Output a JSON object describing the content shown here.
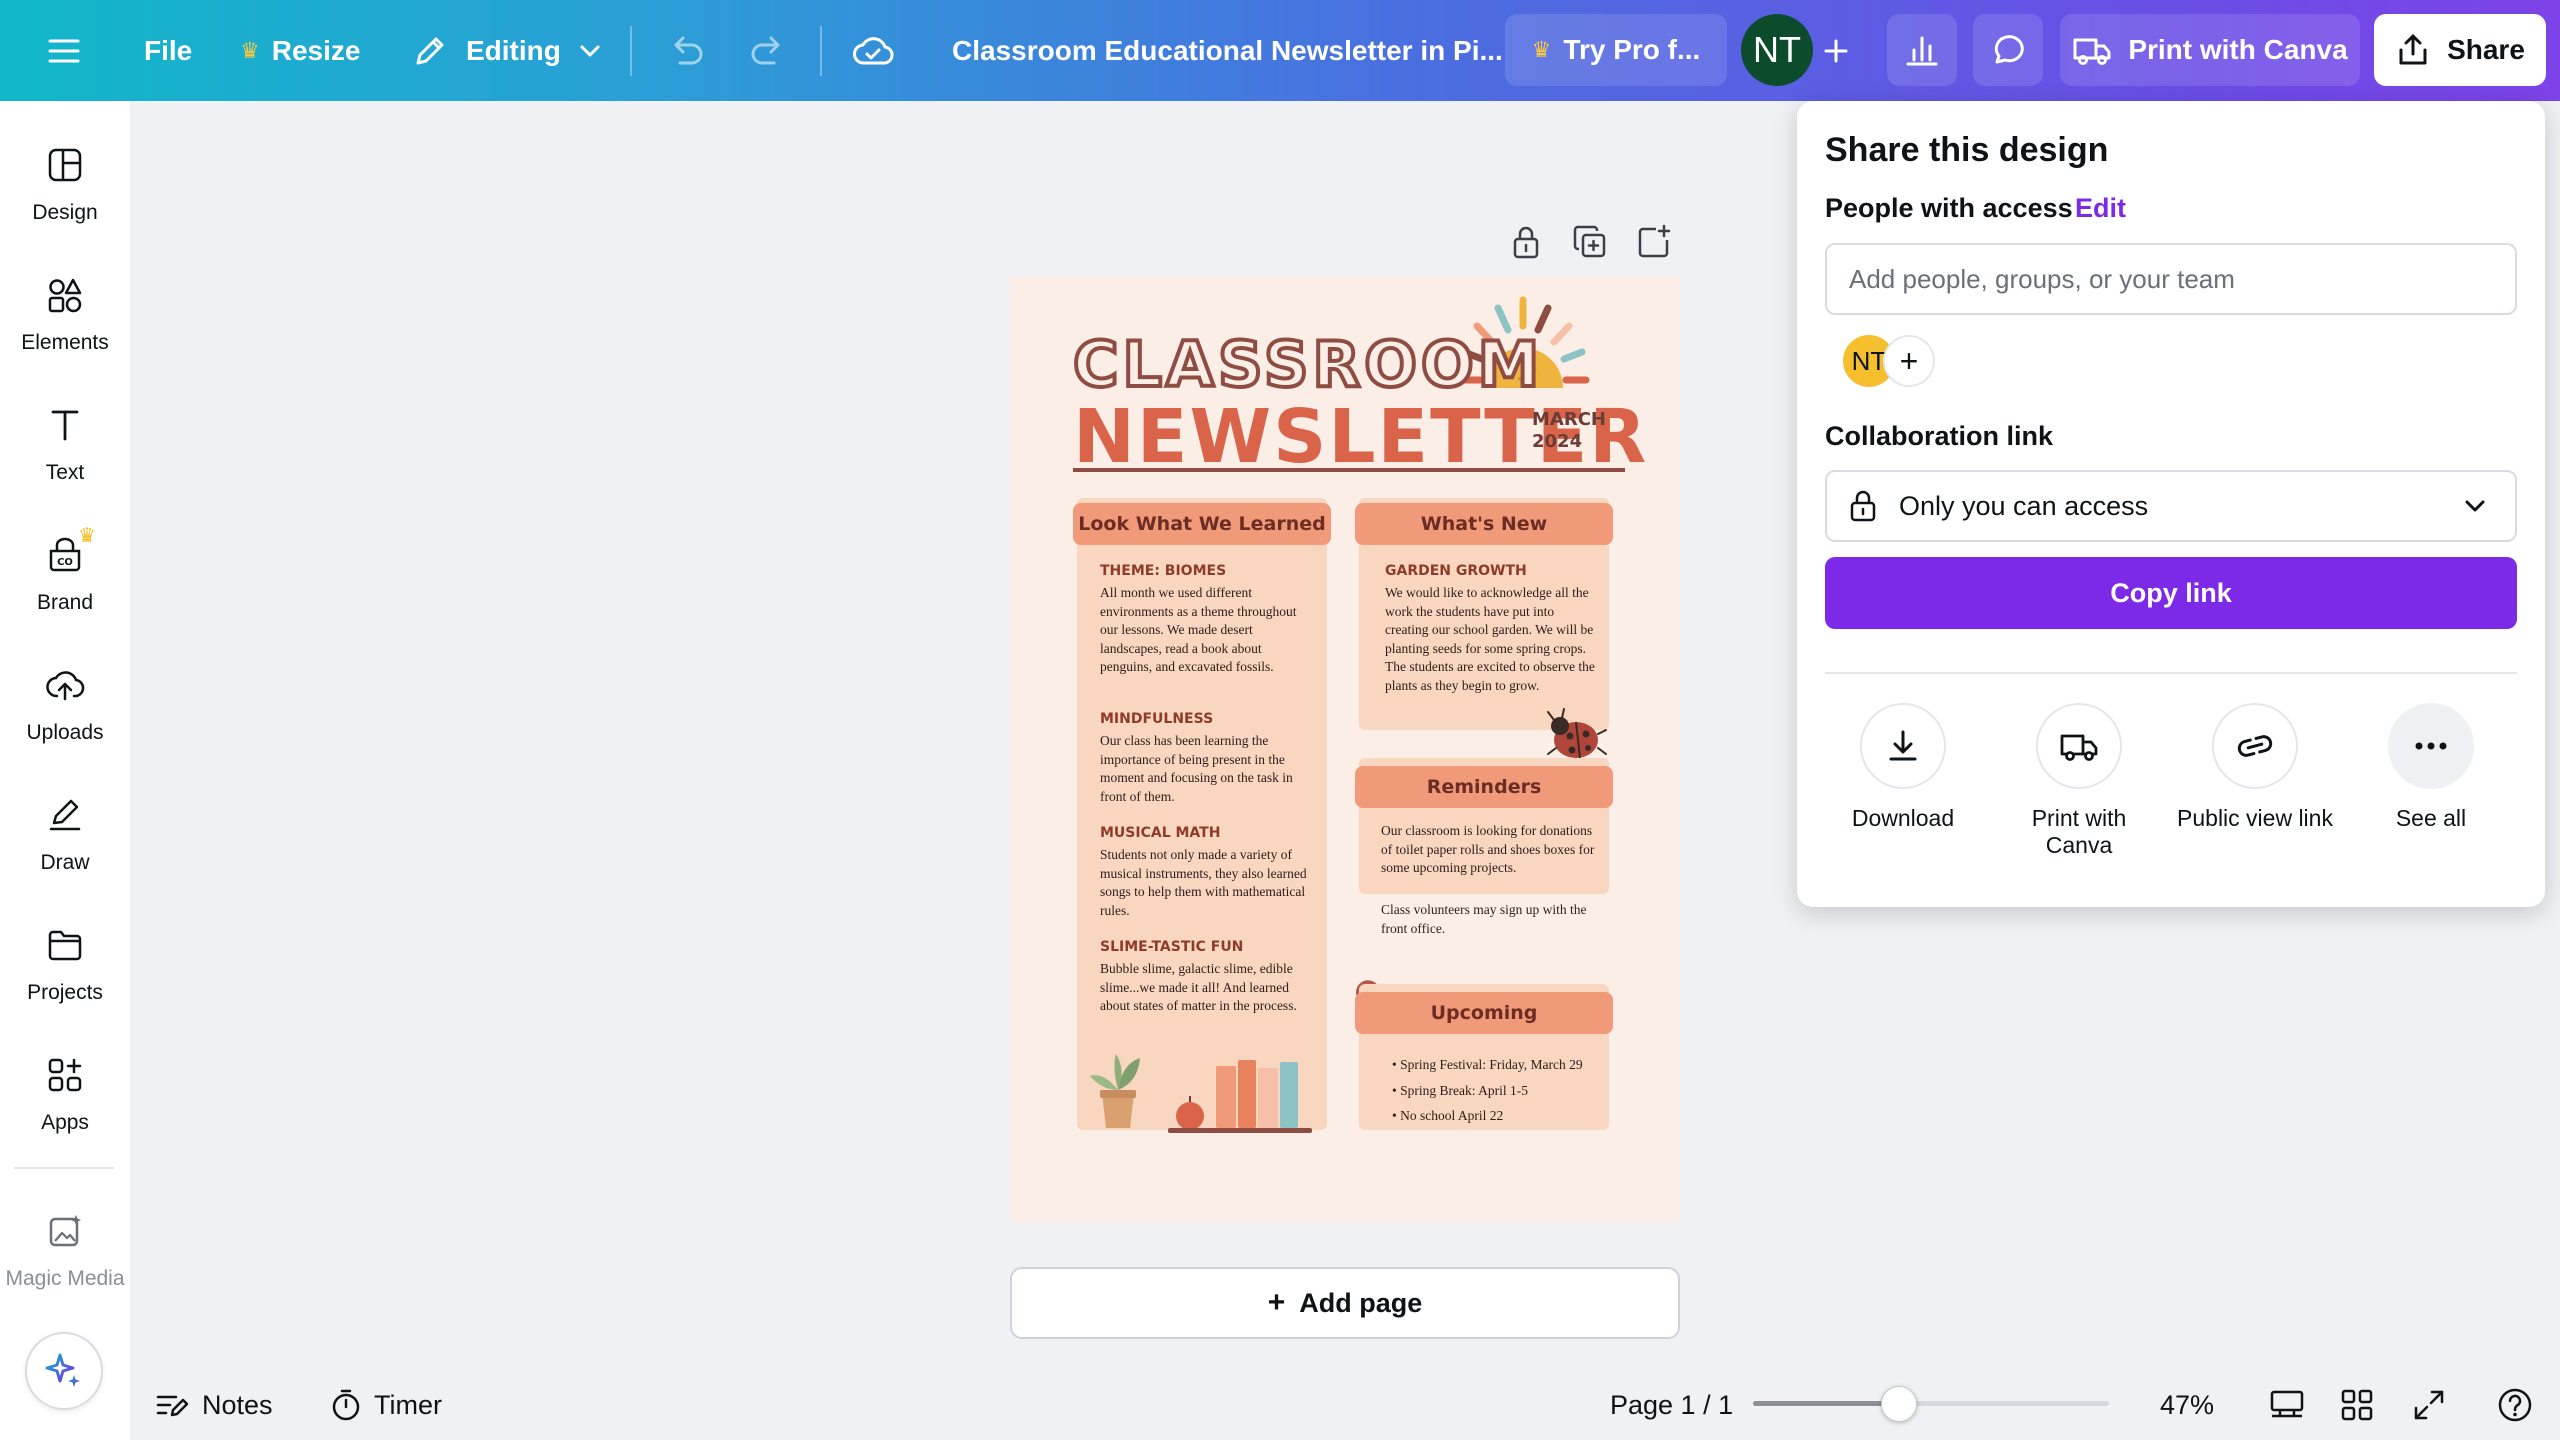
{
  "topbar": {
    "file": "File",
    "resize": "Resize",
    "editing": "Editing",
    "doc_title": "Classroom Educational Newsletter in Pi...",
    "try_pro": "Try Pro f...",
    "avatar_initials": "NT",
    "print_with_canva": "Print with Canva",
    "share": "Share",
    "gradient_start": "#11b7c9",
    "gradient_end": "#7d43e8"
  },
  "sidebar": {
    "items": [
      {
        "label": "Design",
        "icon": "design-icon"
      },
      {
        "label": "Elements",
        "icon": "elements-icon"
      },
      {
        "label": "Text",
        "icon": "text-icon"
      },
      {
        "label": "Brand",
        "icon": "brand-icon"
      },
      {
        "label": "Uploads",
        "icon": "uploads-icon"
      },
      {
        "label": "Draw",
        "icon": "draw-icon"
      },
      {
        "label": "Projects",
        "icon": "projects-icon"
      },
      {
        "label": "Apps",
        "icon": "apps-icon"
      },
      {
        "label": "Magic Media",
        "icon": "magic-media-icon"
      }
    ]
  },
  "newsletter": {
    "title_line1": "CLASSROOM",
    "title_line2": "NEWSLETTER",
    "month": "MARCH",
    "year": "2024",
    "left_col": {
      "header": "Look What We Learned",
      "sections": [
        {
          "heading": "THEME: BIOMES",
          "body": "All month we used different environments as a theme throughout our lessons. We made desert landscapes, read a book about penguins, and excavated fossils."
        },
        {
          "heading": "MINDFULNESS",
          "body": "Our class has been learning the importance of being present in the moment and focusing on the task in front of them."
        },
        {
          "heading": "MUSICAL MATH",
          "body": "Students not only made a variety of musical instruments, they also learned songs to help them with mathematical rules."
        },
        {
          "heading": "SLIME-TASTIC FUN",
          "body": "Bubble slime, galactic slime, edible slime...we made it all! And learned about states of matter in the process."
        }
      ]
    },
    "whats_new": {
      "header": "What's New",
      "heading": "GARDEN GROWTH",
      "body": "We would like to acknowledge all the work the students have put into creating our school garden. We will be planting seeds for some spring crops. The students are excited to observe the plants as they begin to grow."
    },
    "reminders": {
      "header": "Reminders",
      "body1": "Our classroom is looking for donations of toilet paper rolls and shoes boxes for some upcoming projects.",
      "body2": "Class volunteers may sign up with the front office."
    },
    "upcoming": {
      "header": "Upcoming",
      "items": [
        "Spring Festival: Friday, March 29",
        "Spring Break: April 1-5",
        "No school April 22"
      ]
    }
  },
  "canvas": {
    "add_page": "Add page"
  },
  "share_panel": {
    "title": "Share this design",
    "people_with_access": "People with access",
    "edit": "Edit",
    "add_people_placeholder": "Add people, groups, or your team",
    "member_initials": "NT",
    "collaboration_link": "Collaboration link",
    "access_level": "Only you can access",
    "copy_link": "Copy link",
    "accent_color": "#7d2ae8",
    "actions": [
      {
        "label": "Download",
        "icon": "download-icon"
      },
      {
        "label": "Print with Canva",
        "icon": "truck-icon"
      },
      {
        "label": "Public view link",
        "icon": "link-icon"
      },
      {
        "label": "See all",
        "icon": "more-icon"
      }
    ]
  },
  "bottombar": {
    "notes": "Notes",
    "timer": "Timer",
    "page_indicator": "Page 1 / 1",
    "zoom": "47%",
    "zoom_slider_level": 0.41
  }
}
